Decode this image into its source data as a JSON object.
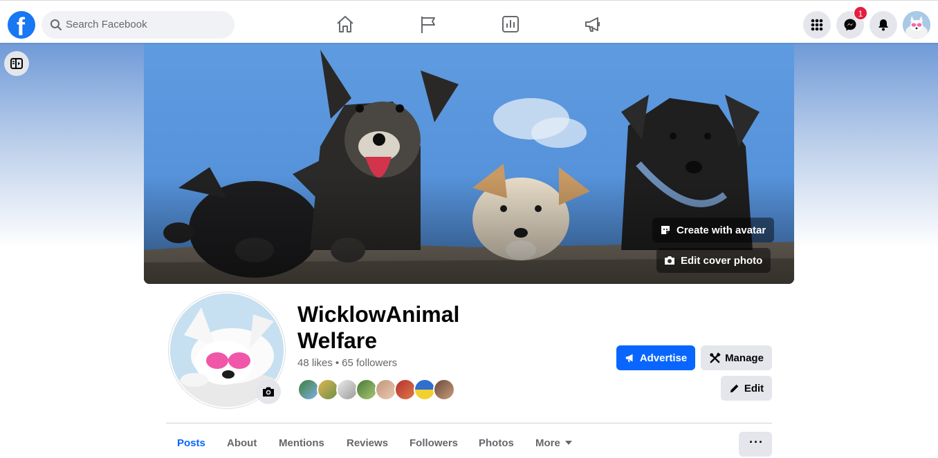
{
  "search": {
    "placeholder": "Search Facebook"
  },
  "nav": {
    "icons": [
      "home-icon",
      "pages-flag-icon",
      "insights-icon",
      "ads-megaphone-icon"
    ],
    "right_icons": [
      "menu-grid-icon",
      "messenger-icon",
      "notifications-bell-icon"
    ],
    "messenger_badge": "1"
  },
  "cover": {
    "create_avatar_label": "Create with avatar",
    "edit_cover_label": "Edit cover photo"
  },
  "page": {
    "name": "WicklowAnimal Welfare",
    "likes": "48 likes",
    "separator": "•",
    "followers": "65 followers"
  },
  "actions": {
    "advertise_label": "Advertise",
    "manage_label": "Manage",
    "edit_label": "Edit",
    "more_options_label": "···"
  },
  "tabs": [
    {
      "label": "Posts",
      "active": true
    },
    {
      "label": "About"
    },
    {
      "label": "Mentions"
    },
    {
      "label": "Reviews"
    },
    {
      "label": "Followers"
    },
    {
      "label": "Photos"
    },
    {
      "label": "More"
    }
  ],
  "colors": {
    "brand_blue": "#0866ff",
    "badge_red": "#e41e3f",
    "muted_text": "#65676b"
  }
}
